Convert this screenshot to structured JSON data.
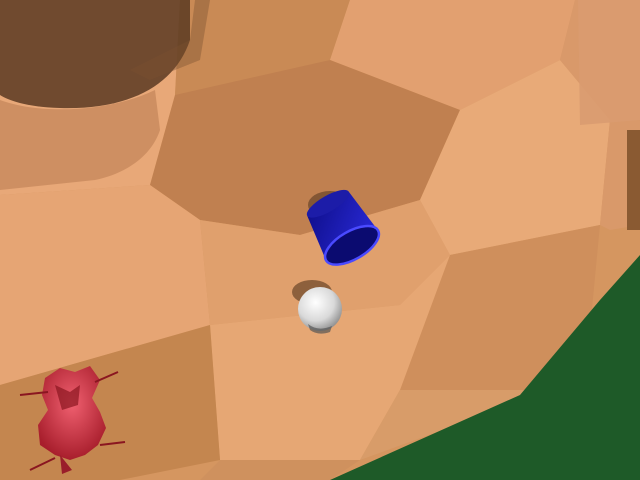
{
  "scene": {
    "description_visible_text": "",
    "objects": [
      {
        "id": "blue-cup",
        "kind": "cup",
        "color": "#1a1ab0"
      },
      {
        "id": "white-ball",
        "kind": "ball",
        "color": "#e8e8e8"
      },
      {
        "id": "red-object",
        "kind": "irregular-object",
        "color": "#c0303a"
      }
    ],
    "floor": {
      "light_tile": "#e3a274",
      "dark_tile": "#c98a55",
      "green": "#1e5a28"
    }
  }
}
